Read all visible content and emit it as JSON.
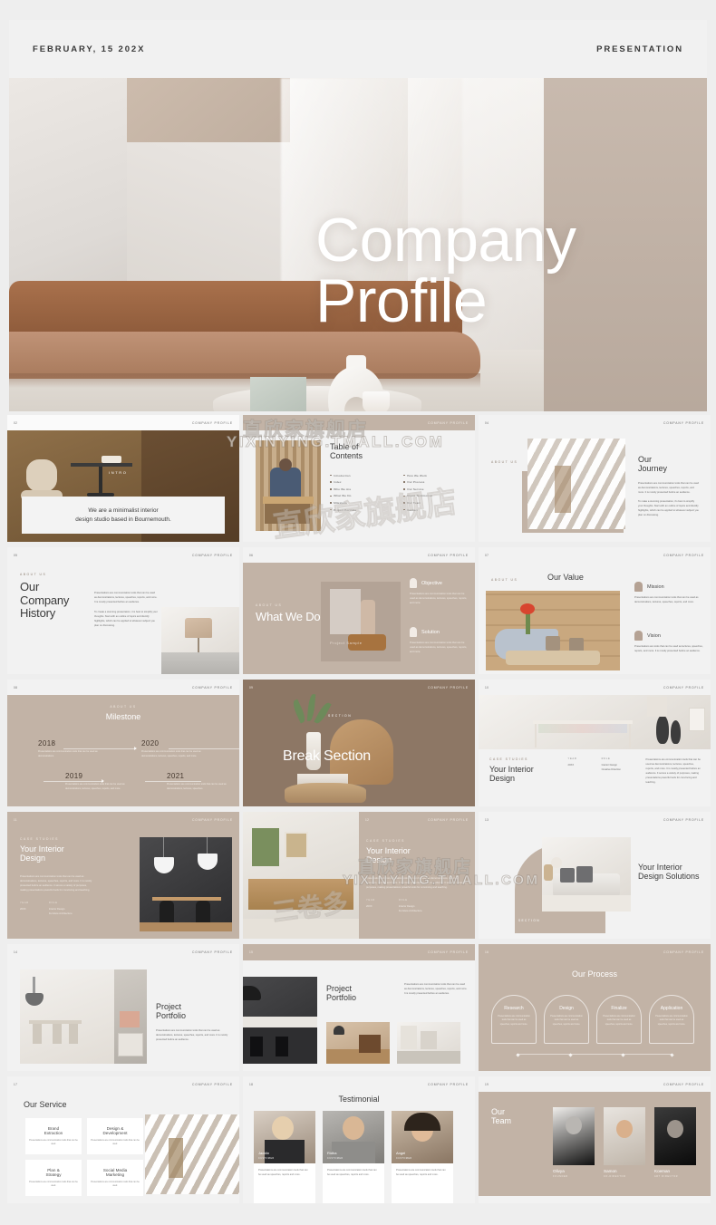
{
  "topbar": {
    "date": "FEBRUARY, 15 202X",
    "label": "PRESENTATION"
  },
  "hero": {
    "title_line1": "Company",
    "title_line2": "Profile"
  },
  "brand": "COMPANY PROFILE",
  "watermarks": {
    "cn": "直欣家旗舰店",
    "en": "YIXINYING.TMALL.COM",
    "cn2": "三卷多"
  },
  "slides": [
    {
      "num": "02",
      "tag": "INTRO",
      "card_line1": "We are a minimalist interior",
      "card_line2": "design studio based in Bournemouth."
    },
    {
      "num": "03",
      "title_l1": "Table of",
      "title_l2": "Contents",
      "toc_left": [
        "Introduction",
        "Index",
        "Who We Are",
        "What We Do",
        "Milestone",
        "Project Portfolio"
      ],
      "toc_right": [
        "How We Work",
        "Our Process",
        "Our Service",
        "Client Testimonial",
        "Our Team",
        "Contact"
      ]
    },
    {
      "num": "04",
      "eyebrow": "ABOUT US",
      "title_l1": "Our",
      "title_l2": "Journey",
      "p1": "Presentations are communication tools that can be used as demonstrations, lectures, speeches, reports, and more. It is mostly presented before an audience.",
      "p2": "To make a stunning presentation, it's best to simplify your thoughts. Start with an outline of topics and identify highlights, which can be applied to whatever subject you plan on discussing."
    },
    {
      "num": "05",
      "eyebrow": "ABOUT US",
      "title_l1": "Our",
      "title_l2": "Company",
      "title_l3": "History",
      "p1": "Presentations are communication tools that can be used as demonstrations, lectures, speeches, reports, and more. It is mostly presented before an audience.",
      "p2": "To create a stunning presentation, it is best to simplify your thoughts. Start with an outline of topics and identify highlights, which can be applied to whatever subject you plan on discussing."
    },
    {
      "num": "06",
      "eyebrow": "ABOUT US",
      "title": "What We Do",
      "project_sample": "Project Sample",
      "item1_title": "Objective",
      "item1_body": "Presentations are communication tools that can be used as demonstrations, lectures, speeches, reports, and more.",
      "item2_title": "Solution",
      "item2_body": "Presentations are communication tools that can be used as demonstrations, lectures, speeches, reports, and more."
    },
    {
      "num": "07",
      "eyebrow": "ABOUT US",
      "title": "Our Value",
      "item1_title": "Mission",
      "item1_body": "Presentations are communication tools that can be used as demonstrations, lectures, speeches, reports, and more.",
      "item2_title": "Vision",
      "item2_body": "Presentations are tools that can be used as lectures, speeches, reports, and more. It is mostly presented before an audience."
    },
    {
      "num": "08",
      "eyebrow": "ABOUT US",
      "title": "Milestone",
      "years": [
        {
          "year": "2018",
          "text": "Presentations are communication tools that can be used as demonstrations."
        },
        {
          "year": "2020",
          "text": "Presentations are communication tools that can be used as demonstrations, lectures, speeches, reports, and more."
        },
        {
          "year": "2019",
          "text": "Presentations are communication tools that can be used as demonstrations, lectures, speeches, reports, and more."
        },
        {
          "year": "2021",
          "text": "Presentations are communication tools that can be used as demonstrations, lectures, speeches."
        }
      ]
    },
    {
      "num": "09",
      "tag": "SECTION",
      "title": "Break Section"
    },
    {
      "num": "10",
      "eyebrow": "CASE STUDIES",
      "title_l1": "Your Interior",
      "title_l2": "Design",
      "year_label": "YEAR",
      "year_value": "20XX",
      "role_label": "ROLE",
      "role_value1": "Interior Design",
      "role_value2": "Creative Direction",
      "body": "Presentations are communication tools that can be used as demonstrations, lectures, speeches, reports, and more. It is mostly presented before an audience. It serves a variety of purposes, making presentations powerful tools for convincing and teaching."
    },
    {
      "num": "11",
      "eyebrow": "CASE STUDIES",
      "title_l1": "Your Interior",
      "title_l2": "Design",
      "body": "Presentations are communication tools that can be used as demonstrations, lectures, speeches, reports, and more. It is mostly presented before an audience. It serves a variety of purposes, making presentations powerful tools for convincing and teaching.",
      "year_label": "YEAR",
      "year_value": "20XX",
      "role_label": "ROLE",
      "role_value1": "Interior Design",
      "role_value2": "Furniture Architecture"
    },
    {
      "num": "12",
      "eyebrow": "CASE STUDIES",
      "title_l1": "Your Interior",
      "title_l2": "Design",
      "body": "Presentations are communication tools that can be used as demonstrations, lectures, speeches, reports, and more. It is mostly presented before an audience. It serves a variety of purposes, making presentations powerful tools for convincing and teaching.",
      "year_label": "YEAR",
      "year_value": "20XX",
      "role_label": "ROLE",
      "role_value1": "Interior Design",
      "role_value2": "Furniture Architecture"
    },
    {
      "num": "13",
      "title_l1": "Your Interior",
      "title_l2": "Design Solutions",
      "tag": "SECTION"
    },
    {
      "num": "14",
      "title_l1": "Project",
      "title_l2": "Portfolio",
      "body": "Presentations are communication tools that can be used as demonstrations, lectures, speeches, reports, and more. It is mostly presented before an audience."
    },
    {
      "num": "15",
      "title_l1": "Project",
      "title_l2": "Portfolio",
      "body": "Presentations are communication tools that can be used as demonstrations, lectures, speeches, reports, and more. It is mostly presented before an audience."
    },
    {
      "num": "16",
      "title": "Our Process",
      "steps": [
        {
          "name": "Research",
          "text": "Presentations are communication tools that can be used as speeches, reports and more."
        },
        {
          "name": "Design",
          "text": "Presentations are communication tools that can be used as speeches, reports and more."
        },
        {
          "name": "Finalize",
          "text": "Presentations are communication tools that can be used as speeches, reports and more."
        },
        {
          "name": "Application",
          "text": "Presentations are communication tools that can be used as speeches, reports and more."
        }
      ]
    },
    {
      "num": "17",
      "title": "Our Service",
      "services": [
        {
          "title_l1": "Brand",
          "title_l2": "Extraction",
          "text": "Presentations are communication tools that can be used."
        },
        {
          "title_l1": "Design &",
          "title_l2": "Development",
          "text": "Presentations are communication tools that can be used."
        },
        {
          "title_l1": "Plan &",
          "title_l2": "Strategy",
          "text": "Presentations are communication tools that can be used."
        },
        {
          "title_l1": "Social Media",
          "title_l2": "Marketing",
          "text": "Presentations are communication tools that can be used."
        }
      ]
    },
    {
      "num": "18",
      "title": "Testimonial",
      "testimonials": [
        {
          "name": "Jacklin",
          "role": "CUSTOMER",
          "text": "Presentations are communication tools that can be used as speeches, reports and more."
        },
        {
          "name": "Ridha",
          "role": "CUSTOMER",
          "text": "Presentations are communication tools that can be used as speeches, reports and more."
        },
        {
          "name": "Angel",
          "role": "CUSTOMER",
          "text": "Presentations are communication tools that can be used as speeches, reports and more."
        }
      ]
    },
    {
      "num": "19",
      "title_l1": "Our",
      "title_l2": "Team",
      "members": [
        {
          "name": "Olivya",
          "role": "FOUNDER"
        },
        {
          "name": "Samon",
          "role": "CO-DIRECTOR"
        },
        {
          "name": "Koeman",
          "role": "ART DIRECTOR"
        }
      ]
    }
  ],
  "colors": {
    "taupe": "#c2b3a6",
    "dark_taupe": "#8d7765",
    "bg": "#eeeeee",
    "panel": "#f2f2f2"
  }
}
